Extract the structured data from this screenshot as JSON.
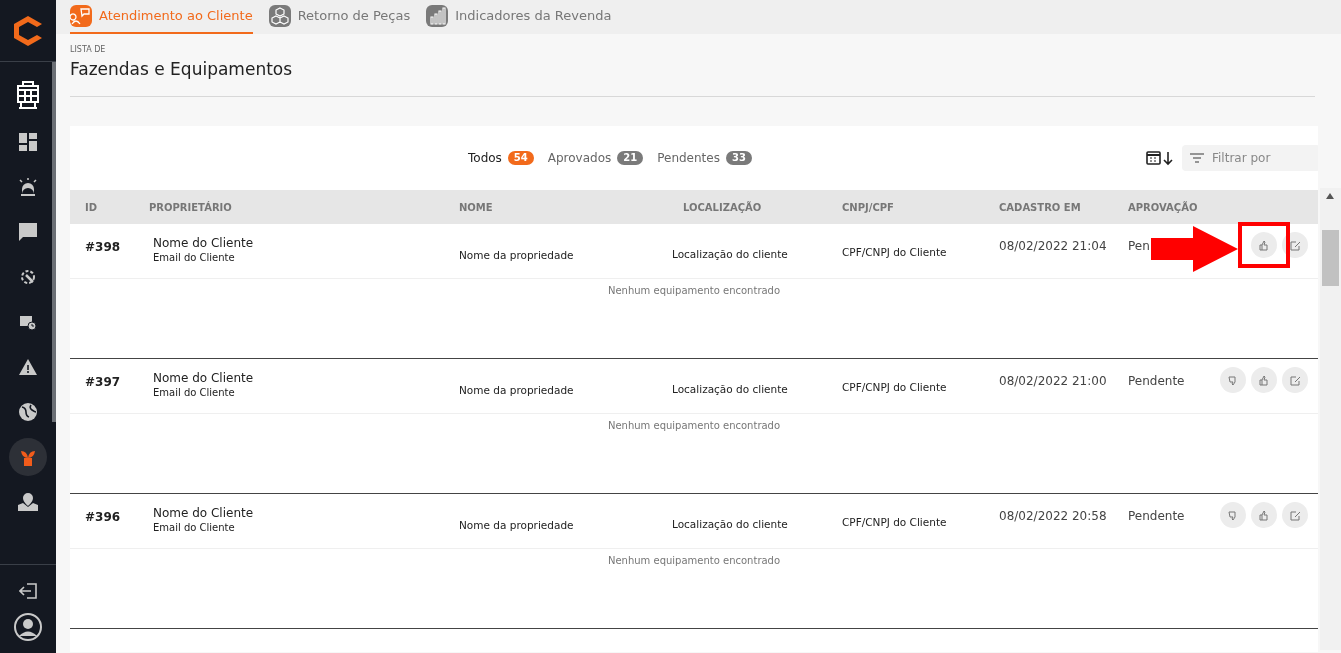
{
  "top_tabs": [
    {
      "label": "Atendimento ao Cliente",
      "selected": true
    },
    {
      "label": "Retorno de Peças",
      "selected": false
    },
    {
      "label": "Indicadores da Revenda",
      "selected": false
    }
  ],
  "sidebar": {
    "items": [
      {
        "selected": false
      },
      {
        "selected": false
      },
      {
        "selected": false
      },
      {
        "selected": false
      },
      {
        "selected": false
      },
      {
        "selected": false
      },
      {
        "selected": false
      },
      {
        "selected": false
      },
      {
        "selected": true
      },
      {
        "selected": false
      }
    ]
  },
  "page": {
    "eyebrow": "LISTA DE",
    "title": "Fazendas e Equipamentos"
  },
  "filters": [
    {
      "label": "Todos",
      "count": "54",
      "selected": true
    },
    {
      "label": "Aprovados",
      "count": "21",
      "selected": false
    },
    {
      "label": "Pendentes",
      "count": "33",
      "selected": false
    }
  ],
  "filter_field": {
    "placeholder": "Filtrar por"
  },
  "table": {
    "columns": [
      "ID",
      "PROPRIETÁRIO",
      "NOME",
      "LOCALIZAÇÃO",
      "CNPJ/CPF",
      "CADASTRO EM",
      "APROVAÇÃO"
    ],
    "rows": [
      {
        "id": "#398",
        "owner": "Nome do Cliente",
        "email": "Email do Cliente",
        "name": "Nome da propriedade",
        "location": "Localização do cliente",
        "document": "CPF/CNPJ do Cliente",
        "created": "08/02/2022 21:04",
        "status": "Pen",
        "empty_note": "Nenhum equipamento encontrado",
        "annotated": true
      },
      {
        "id": "#397",
        "owner": "Nome do Cliente",
        "email": "Email do Cliente",
        "name": "Nome da propriedade",
        "location": "Localização do cliente",
        "document": "CPF/CNPJ do Cliente",
        "created": "08/02/2022 21:00",
        "status": "Pendente",
        "empty_note": "Nenhum equipamento encontrado",
        "annotated": false
      },
      {
        "id": "#396",
        "owner": "Nome do Cliente",
        "email": "Email do Cliente",
        "name": "Nome da propriedade",
        "location": "Localização do cliente",
        "document": "CPF/CNPJ do Cliente",
        "created": "08/02/2022 20:58",
        "status": "Pendente",
        "empty_note": "Nenhum equipamento encontrado",
        "annotated": false
      }
    ]
  }
}
